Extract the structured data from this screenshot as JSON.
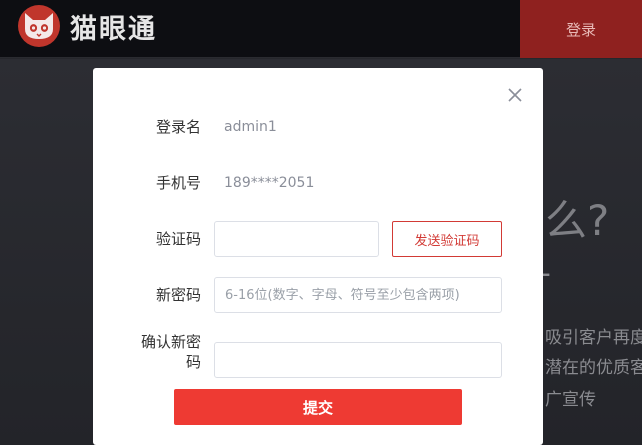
{
  "header": {
    "brand": "猫眼通",
    "login_label": "登录"
  },
  "background": {
    "heading": "么?",
    "line1": "吸引客户再度",
    "line2": "潜在的优质客",
    "line3": "广宣传"
  },
  "form": {
    "username_label": "登录名",
    "username_value": "admin1",
    "phone_label": "手机号",
    "phone_value": "189****2051",
    "code_label": "验证码",
    "code_value": "",
    "send_code_label": "发送验证码",
    "new_password_label": "新密码",
    "new_password_placeholder": "6-16位(数字、字母、符号至少包含两项)",
    "confirm_label_line1": "确认新密",
    "confirm_label_line2": "码",
    "confirm_value": "",
    "submit_label": "提交"
  },
  "colors": {
    "accent": "#ee3a33",
    "header_login_bg": "#8f211f",
    "topbar_bg": "#0d0e12"
  },
  "icons": {
    "logo": "cat-logo-icon",
    "close": "close-icon"
  }
}
